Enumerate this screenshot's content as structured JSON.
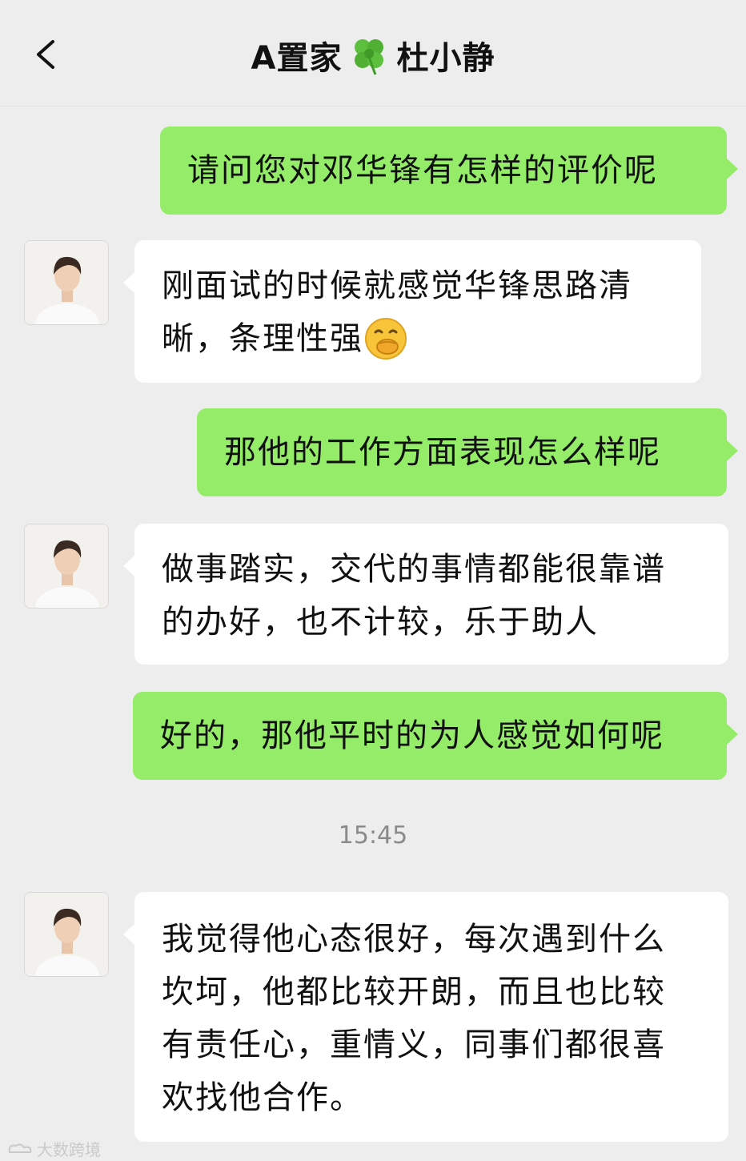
{
  "header": {
    "title_prefix": "A置家",
    "title_suffix": "杜小静",
    "back_icon": "chevron-left-icon",
    "clover_icon": "four-leaf-clover-icon"
  },
  "messages": [
    {
      "side": "out",
      "text": "请问您对邓华锋有怎样的评价呢"
    },
    {
      "side": "in",
      "lines": [
        "刚面试的时候就感觉华锋思路清",
        "晰，条理性强"
      ],
      "emoji": "hand-over-mouth-emoji"
    },
    {
      "side": "out",
      "text": "那他的工作方面表现怎么样呢"
    },
    {
      "side": "in",
      "lines": [
        "做事踏实，交代的事情都能很靠谱",
        "的办好，也不计较，乐于助人"
      ]
    },
    {
      "side": "out",
      "text": "好的，那他平时的为人感觉如何呢"
    },
    {
      "side": "in",
      "lines": [
        "我觉得他心态很好，每次遇到什么",
        "坎坷，他都比较开朗，而且也比较",
        "有责任心，重情义，同事们都很喜",
        "欢找他合作。"
      ]
    }
  ],
  "timestamp": "15:45",
  "watermark": "大数跨境",
  "colors": {
    "background": "#ededed",
    "outgoing_bubble": "#95ec69",
    "incoming_bubble": "#ffffff"
  }
}
